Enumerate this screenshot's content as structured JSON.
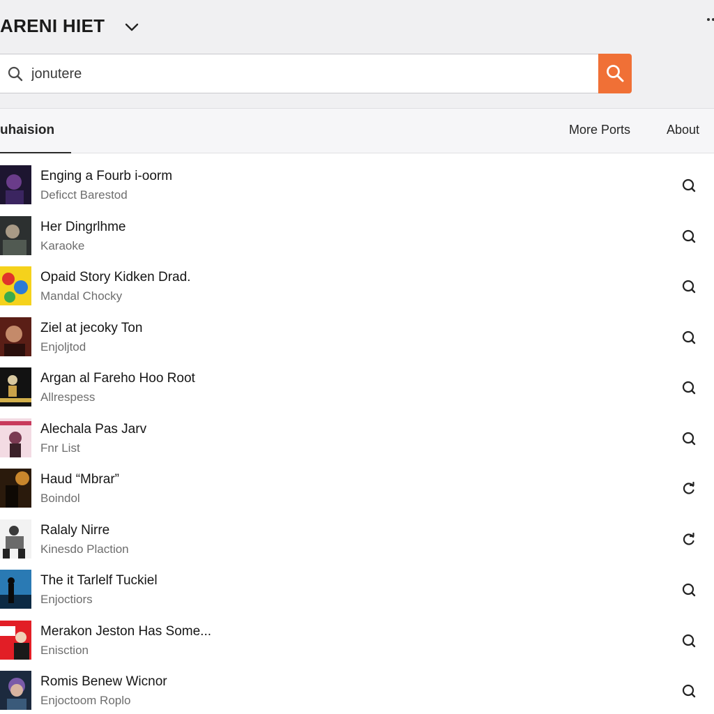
{
  "header": {
    "title": "ARENI HIET",
    "title_dropdown_icon": "chevron-down-icon",
    "overflow_icon": "more-dots-icon"
  },
  "search": {
    "value": "jonutere",
    "placeholder": "",
    "button_icon": "search-icon",
    "button_color": "#f07036"
  },
  "tabs": [
    {
      "label": "uhaision",
      "active": true
    },
    {
      "label": "More Ports",
      "active": false
    },
    {
      "label": "About",
      "active": false
    }
  ],
  "items": [
    {
      "title": "Enging a Fourb i-oorm",
      "subtitle": "Deficct Barestod",
      "action_icon": "search-icon"
    },
    {
      "title": "Her Dingrlhme",
      "subtitle": "Karaoke",
      "action_icon": "search-icon"
    },
    {
      "title": "Opaid Story Kidken Drad.",
      "subtitle": "Mandal Chocky",
      "action_icon": "search-icon"
    },
    {
      "title": "Ziel at jecoky Ton",
      "subtitle": "Enjoljtod",
      "action_icon": "search-icon"
    },
    {
      "title": "Argan al Fareho Hoo Root",
      "subtitle": "Allrespess",
      "action_icon": "search-icon"
    },
    {
      "title": "Alechala Pas Jarv",
      "subtitle": "Fnr List",
      "action_icon": "search-icon"
    },
    {
      "title": "Haud “Mbrar”",
      "subtitle": "Boindol",
      "action_icon": "refresh-icon"
    },
    {
      "title": "Ralaly Nirre",
      "subtitle": "Kinesdo Plaction",
      "action_icon": "refresh-icon"
    },
    {
      "title": "The it Tarlelf Tuckiel",
      "subtitle": "Enjoctiors",
      "action_icon": "search-icon"
    },
    {
      "title": "Merakon Jeston Has Some...",
      "subtitle": "Eniscti​on",
      "action_icon": "search-icon"
    },
    {
      "title": "Romis Benew Wicnor",
      "subtitle": "Enjoctoom Roplo",
      "action_icon": "search-icon"
    }
  ],
  "colors": {
    "accent": "#f07036",
    "header_bg": "#f0f0f2",
    "tabbar_bg": "#f6f6f8"
  }
}
